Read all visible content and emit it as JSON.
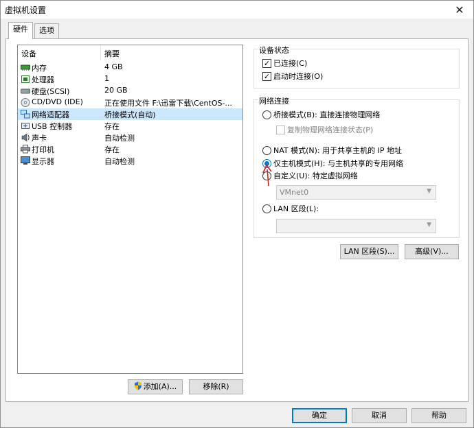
{
  "window": {
    "title": "虚拟机设置",
    "close_glyph": "✕"
  },
  "tabs": [
    {
      "label": "硬件",
      "active": true
    },
    {
      "label": "选项",
      "active": false
    }
  ],
  "device_list": {
    "columns": {
      "device": "设备",
      "summary": "摘要"
    },
    "rows": [
      {
        "name": "内存",
        "summary": "4 GB",
        "icon": "memory-icon"
      },
      {
        "name": "处理器",
        "summary": "1",
        "icon": "cpu-icon"
      },
      {
        "name": "硬盘(SCSI)",
        "summary": "20 GB",
        "icon": "harddisk-icon"
      },
      {
        "name": "CD/DVD (IDE)",
        "summary": "正在使用文件 F:\\迅雷下载\\CentOS-...",
        "icon": "cd-dvd-icon"
      },
      {
        "name": "网络适配器",
        "summary": "桥接模式(自动)",
        "icon": "network-adapter-icon",
        "selected": true
      },
      {
        "name": "USB 控制器",
        "summary": "存在",
        "icon": "usb-icon"
      },
      {
        "name": "声卡",
        "summary": "自动检测",
        "icon": "sound-card-icon"
      },
      {
        "name": "打印机",
        "summary": "存在",
        "icon": "printer-icon"
      },
      {
        "name": "显示器",
        "summary": "自动检测",
        "icon": "display-icon"
      }
    ],
    "add_button": "添加(A)...",
    "remove_button": "移除(R)"
  },
  "device_status": {
    "title": "设备状态",
    "connected": {
      "label": "已连接(C)",
      "checked": true
    },
    "connect_at_power_on": {
      "label": "启动时连接(O)",
      "checked": true
    }
  },
  "network_connection": {
    "title": "网络连接",
    "bridged": {
      "label": "桥接模式(B): 直接连接物理网络",
      "checked": false
    },
    "replicate": {
      "label": "复制物理网络连接状态(P)",
      "checked": false
    },
    "nat": {
      "label": "NAT 模式(N): 用于共享主机的 IP 地址",
      "checked": false
    },
    "host_only": {
      "label": "仅主机模式(H): 与主机共享的专用网络",
      "checked": true
    },
    "custom": {
      "label": "自定义(U): 特定虚拟网络",
      "checked": false
    },
    "custom_select_value": "VMnet0",
    "lan_segment": {
      "label": "LAN 区段(L):",
      "checked": false
    },
    "lan_select_value": "",
    "lan_segments_button": "LAN 区段(S)...",
    "advanced_button": "高级(V)..."
  },
  "footer": {
    "ok": "确定",
    "cancel": "取消",
    "help": "帮助"
  },
  "colors": {
    "accent": "#0078d7",
    "selection": "#cce8ff",
    "annotation_arrow": "#e02020"
  }
}
